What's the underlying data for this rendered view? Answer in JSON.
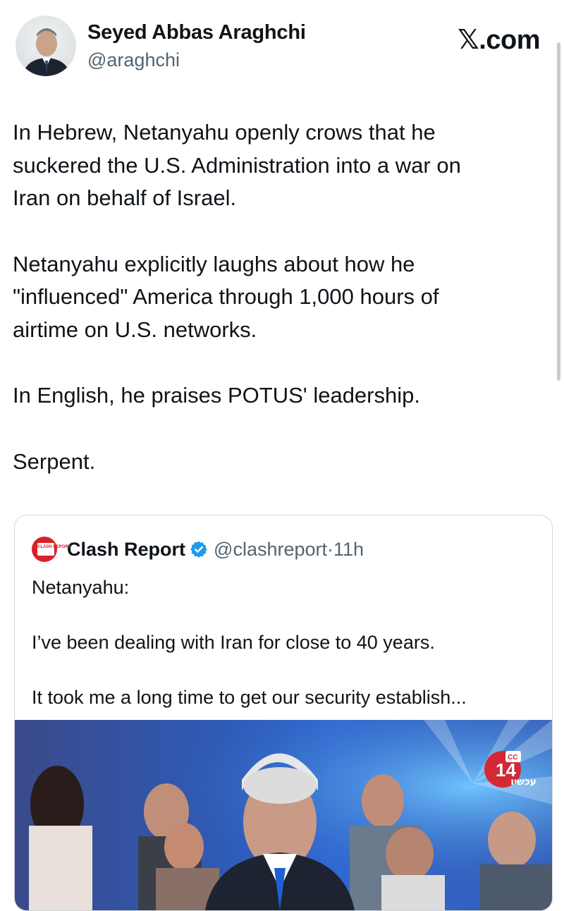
{
  "header": {
    "display_name": "Seyed Abbas Araghchi",
    "handle": "@araghchi",
    "site_label_x": "𝕏",
    "site_label_rest": ".com"
  },
  "tweet": {
    "paragraphs": [
      [
        "In Hebrew, Netanyahu openly crows that he",
        "suckered the U.S. Administration into a war on",
        "Iran on behalf of Israel."
      ],
      [
        "Netanyahu explicitly laughs about how he",
        "\"influenced\" America through 1,000 hours of",
        "airtime on U.S. networks."
      ],
      [
        "In English, he praises POTUS' leadership."
      ],
      [
        "Serpent."
      ]
    ]
  },
  "quoted_tweet": {
    "account_name": "Clash Report",
    "handle": "@clashreport",
    "separator": "·",
    "time": "11h",
    "logo_text": "CLASH REPORT",
    "lines": [
      "Netanyahu:",
      "I’ve been dealing with Iran for close to 40 years.",
      "It took me a long time to get our security establish..."
    ]
  },
  "video": {
    "channel_number": "14",
    "cc_label": "CC",
    "channel_name": "עכשיו"
  },
  "colors": {
    "text": "#0f1419",
    "secondary_text": "#536471",
    "verified_blue": "#1d9bf0",
    "clash_red": "#d8222a",
    "border": "#cfd9de"
  },
  "icons": [
    "avatar-photo",
    "verified-badge-icon",
    "clash-report-logo",
    "channel-14-logo"
  ]
}
